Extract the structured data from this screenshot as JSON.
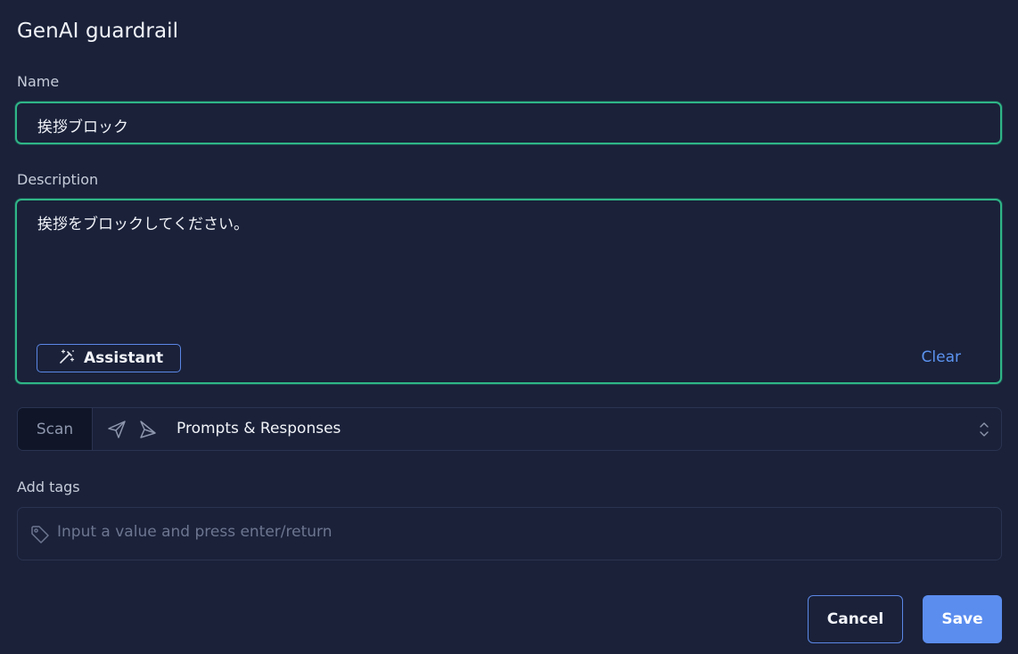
{
  "dialog": {
    "title": "GenAI guardrail"
  },
  "name": {
    "label": "Name",
    "value": "挨拶ブロック"
  },
  "description": {
    "label": "Description",
    "value": "挨拶をブロックしてください。",
    "assistant_label": "Assistant",
    "clear_label": "Clear"
  },
  "scan": {
    "badge": "Scan",
    "value": "Prompts & Responses",
    "icons": [
      "send-outline-icon",
      "send-angled-icon"
    ]
  },
  "tags": {
    "label": "Add tags",
    "placeholder": "Input a value and press enter/return",
    "icon": "tag-icon"
  },
  "actions": {
    "cancel_label": "Cancel",
    "save_label": "Save"
  },
  "colors": {
    "background": "#1a2139",
    "focus_border": "#2fb687",
    "accent": "#5b8def",
    "link": "#5c93f0"
  }
}
